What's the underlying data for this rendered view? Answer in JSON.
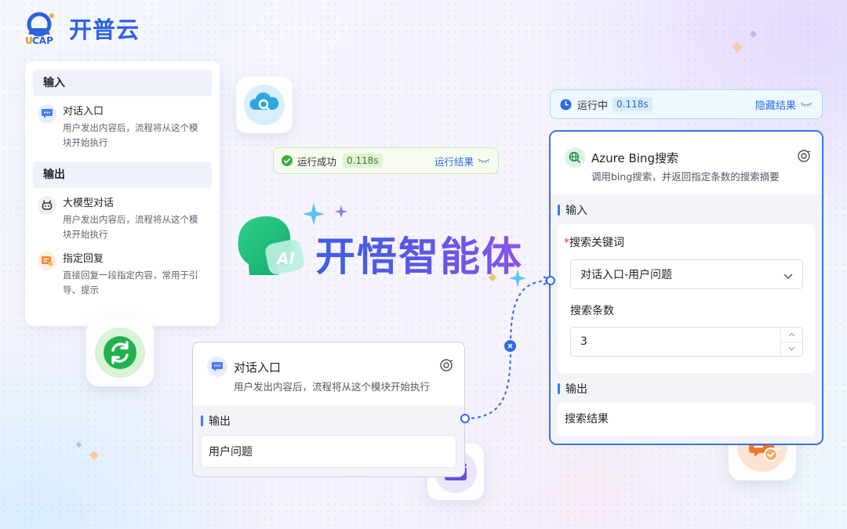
{
  "logo": {
    "mark_text": "UCAP",
    "name": "开普云"
  },
  "left_panel": {
    "input_header": "输入",
    "input_items": [
      {
        "title": "对话入口",
        "desc": [
          "用户发出内容后，流程将从这个模",
          "块开始执行"
        ],
        "icon": "chat-bubble-icon"
      }
    ],
    "output_header": "输出",
    "output_items": [
      {
        "title": "大模型对话",
        "desc": [
          "用户发出内容后，流程将从这个模",
          "块开始执行"
        ],
        "icon": "robot-icon"
      },
      {
        "title": "指定回复",
        "desc": [
          "直接回复一段指定内容，常用于引",
          "导、提示"
        ],
        "icon": "reply-icon"
      }
    ]
  },
  "status_success": {
    "text": "运行成功",
    "time": "0.118s",
    "link": "运行结果"
  },
  "status_running": {
    "text": "运行中",
    "time": "0.118s",
    "link": "隐藏结果"
  },
  "brand_title": "开悟智能体",
  "avatar_badge": "AI",
  "node_entry": {
    "title": "对话入口",
    "desc": "用户发出内容后，流程将从这个模块开始执行",
    "output_label": "输出",
    "output_value": "用户问题"
  },
  "node_bing": {
    "title": "Azure Bing搜索",
    "desc": "调用bing搜索，并返回指定条数的搜索摘要",
    "input_label": "输入",
    "keyword_required_mark": "*",
    "keyword_label": "搜索关键词",
    "keyword_value": "对话入口-用户问题",
    "count_label": "搜索条数",
    "count_value": "3",
    "output_label": "输出",
    "output_value": "搜索结果"
  },
  "colors": {
    "primary": "#2d6ae6",
    "success": "#3fae3f",
    "brand_gradient_start": "#3c5fe8",
    "brand_gradient_end": "#8a55e4"
  }
}
